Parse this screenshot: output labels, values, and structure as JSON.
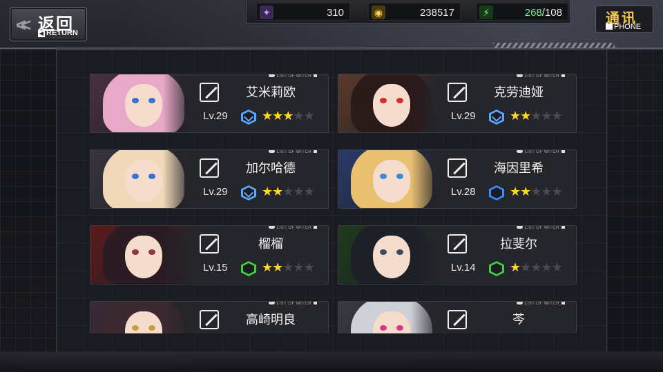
{
  "header": {
    "return": {
      "zh": "返回",
      "en": "RETURN"
    },
    "resources": [
      {
        "icon": "crystal-icon",
        "value": "310"
      },
      {
        "icon": "coin-icon",
        "value": "238517"
      },
      {
        "icon": "energy-icon",
        "current": "268",
        "max": "/108"
      }
    ],
    "phone": {
      "zh": "通讯",
      "en": "PHONE"
    }
  },
  "list_tag": "LIST OF WITCH",
  "cards": [
    {
      "name": "艾米莉欧",
      "level": "Lv.29",
      "stars": 3,
      "max_stars": 5,
      "rank_color": "#5aa8ff",
      "rank_inner": true
    },
    {
      "name": "克劳迪娅",
      "level": "Lv.29",
      "stars": 2,
      "max_stars": 5,
      "rank_color": "#5aa8ff",
      "rank_inner": true
    },
    {
      "name": "加尔哈德",
      "level": "Lv.29",
      "stars": 2,
      "max_stars": 5,
      "rank_color": "#5aa8ff",
      "rank_inner": true
    },
    {
      "name": "海因里希",
      "level": "Lv.28",
      "stars": 2,
      "max_stars": 5,
      "rank_color": "#3a8cff",
      "rank_inner": false
    },
    {
      "name": "榴榴",
      "level": "Lv.15",
      "stars": 2,
      "max_stars": 5,
      "rank_color": "#3cd23c",
      "rank_inner": false
    },
    {
      "name": "拉斐尔",
      "level": "Lv.14",
      "stars": 1,
      "max_stars": 5,
      "rank_color": "#3cd23c",
      "rank_inner": false
    },
    {
      "name": "高崎明良",
      "level": "",
      "stars": 0,
      "max_stars": 5,
      "rank_color": "#3cd23c",
      "rank_inner": false
    },
    {
      "name": "芩",
      "level": "",
      "stars": 0,
      "max_stars": 5,
      "rank_color": "#3cd23c",
      "rank_inner": false
    }
  ]
}
